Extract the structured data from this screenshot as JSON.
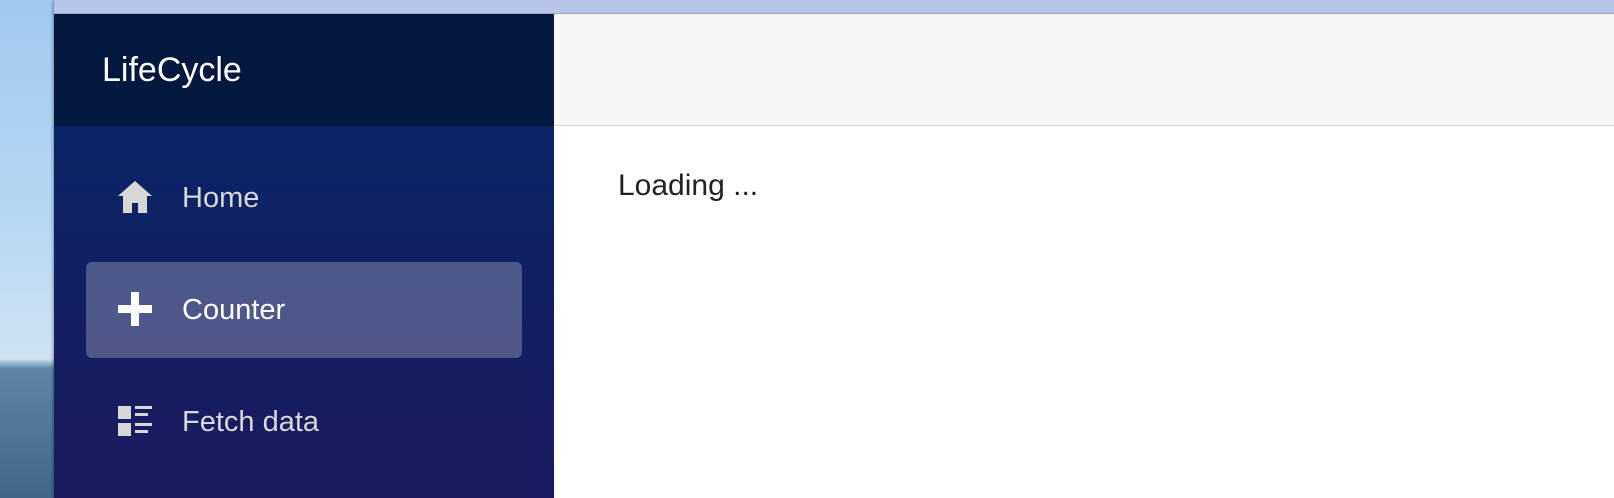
{
  "app": {
    "brand": "LifeCycle"
  },
  "sidebar": {
    "items": [
      {
        "label": "Home",
        "icon": "home-icon",
        "active": false
      },
      {
        "label": "Counter",
        "icon": "plus-icon",
        "active": true
      },
      {
        "label": "Fetch data",
        "icon": "list-rich-icon",
        "active": false
      }
    ]
  },
  "main": {
    "status_text": "Loading ..."
  },
  "colors": {
    "sidebar_top": "#052767",
    "sidebar_bottom": "#1b1a5f",
    "brand_bar": "#04183f",
    "top_row": "#f7f7f7",
    "active_item": "rgba(255,255,255,0.25)",
    "titlebar": "#b6c4ea"
  }
}
